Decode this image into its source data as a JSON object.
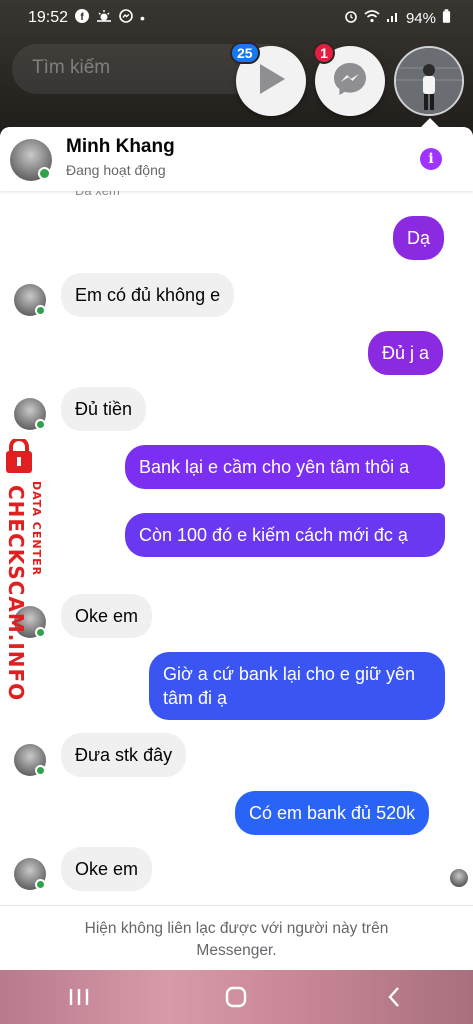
{
  "status_bar": {
    "time": "19:52",
    "battery": "94%",
    "notification_dot": "•"
  },
  "search": {
    "placeholder": "Tìm kiếm"
  },
  "chat_heads": [
    {
      "icon": "play-icon",
      "badge": "25",
      "badge_color": "#1877f2"
    },
    {
      "icon": "messenger-icon",
      "badge": "1",
      "badge_color": "#e41e3f"
    }
  ],
  "header": {
    "name": "Minh Khang",
    "status": "Đang hoạt động",
    "info_label": "i"
  },
  "seen_label": "Đã xem",
  "messages": [
    {
      "side": "out",
      "text": "Dạ"
    },
    {
      "side": "in",
      "text": "Em có đủ không e"
    },
    {
      "side": "out",
      "text": "Đủ j a"
    },
    {
      "side": "in",
      "text": "Đủ tiền"
    },
    {
      "side": "out",
      "text": "Bank lại e cầm cho yên tâm thôi a"
    },
    {
      "side": "out",
      "text": "Còn 100 đó e kiếm cách mới đc ạ"
    },
    {
      "side": "in",
      "text": "Oke em"
    },
    {
      "side": "out",
      "text": "Giờ a cứ bank lại cho e giữ yên tâm đi ạ"
    },
    {
      "side": "in",
      "text": "Đưa stk đây"
    },
    {
      "side": "out",
      "text": "Có em bank đủ 520k"
    },
    {
      "side": "in",
      "text": "Oke em"
    }
  ],
  "watermark": {
    "line1": "DATA CENTER",
    "line2": "CHECKSCAM.INFO"
  },
  "footer": {
    "line1": "Hiện không liên lạc được với người này trên",
    "line2": "Messenger."
  },
  "colors": {
    "accent_purple": "#a033ff",
    "bubble_purple": "#7b2ff2",
    "bubble_blue": "#2a64f6",
    "online_green": "#31a24c"
  }
}
